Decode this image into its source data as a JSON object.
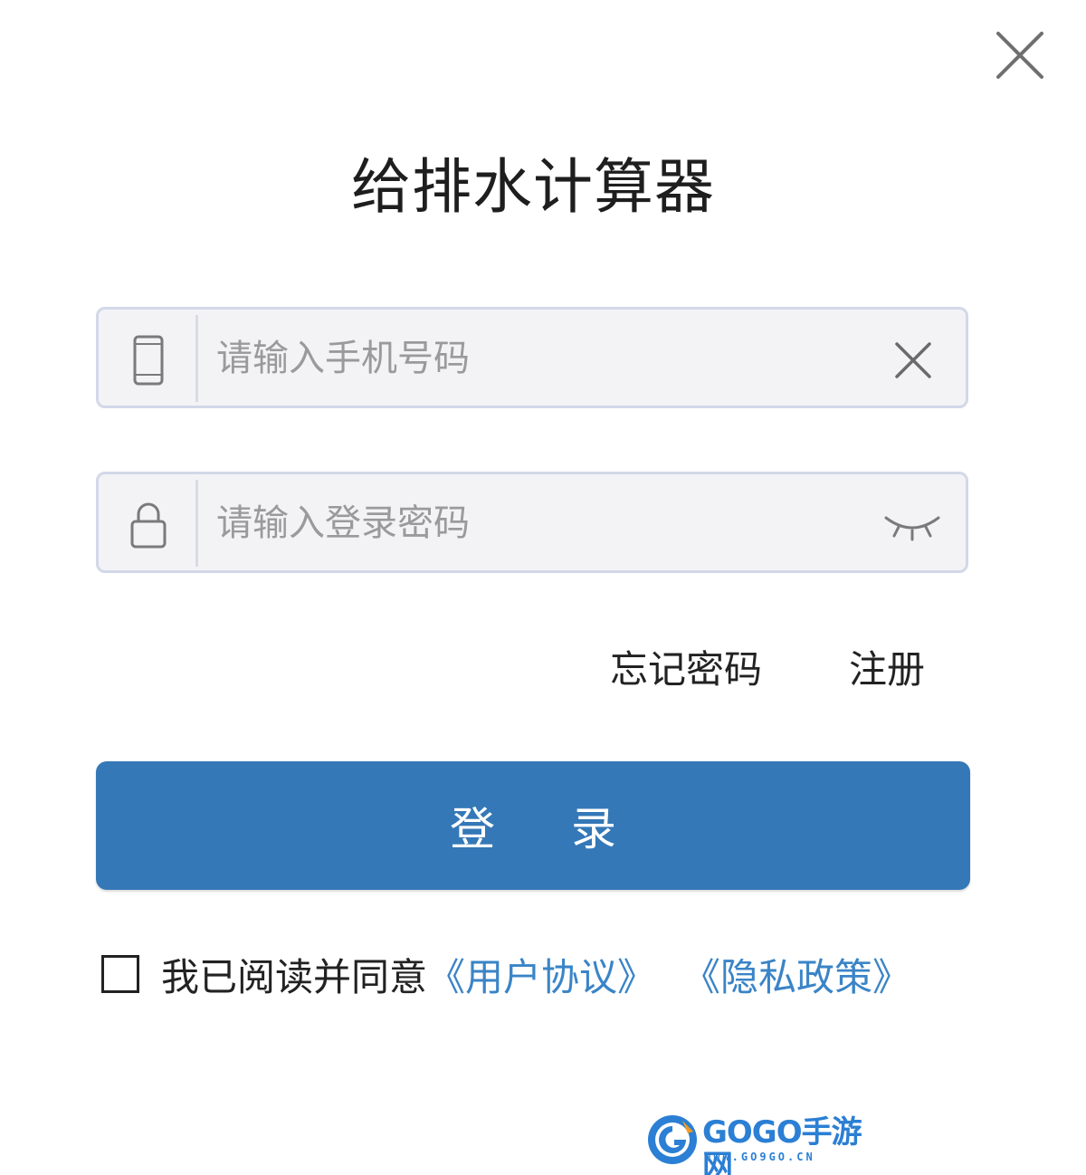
{
  "window": {
    "close_icon": "close-icon"
  },
  "title": "给排水计算器",
  "phone_field": {
    "icon": "phone-icon",
    "placeholder": "请输入手机号码",
    "value": "",
    "clear_icon": "clear-icon"
  },
  "password_field": {
    "icon": "lock-icon",
    "placeholder": "请输入登录密码",
    "value": "",
    "toggle_icon": "eye-closed-icon"
  },
  "links": {
    "forgot_password": "忘记密码",
    "register": "注册"
  },
  "login_button": "登 录",
  "agreement": {
    "checked": false,
    "text": "我已阅读并同意",
    "user_agreement": "《用户协议》",
    "privacy_policy": "《隐私政策》"
  },
  "watermark": {
    "main": "GOGO手游网",
    "sub": "WWW.GO9GO.CN"
  },
  "colors": {
    "primary": "#3478b7",
    "link": "#3a84c7",
    "field_bg": "#f3f3f6",
    "field_border": "#d3d8e8",
    "text": "#222222",
    "placeholder": "#9a9a9a"
  }
}
